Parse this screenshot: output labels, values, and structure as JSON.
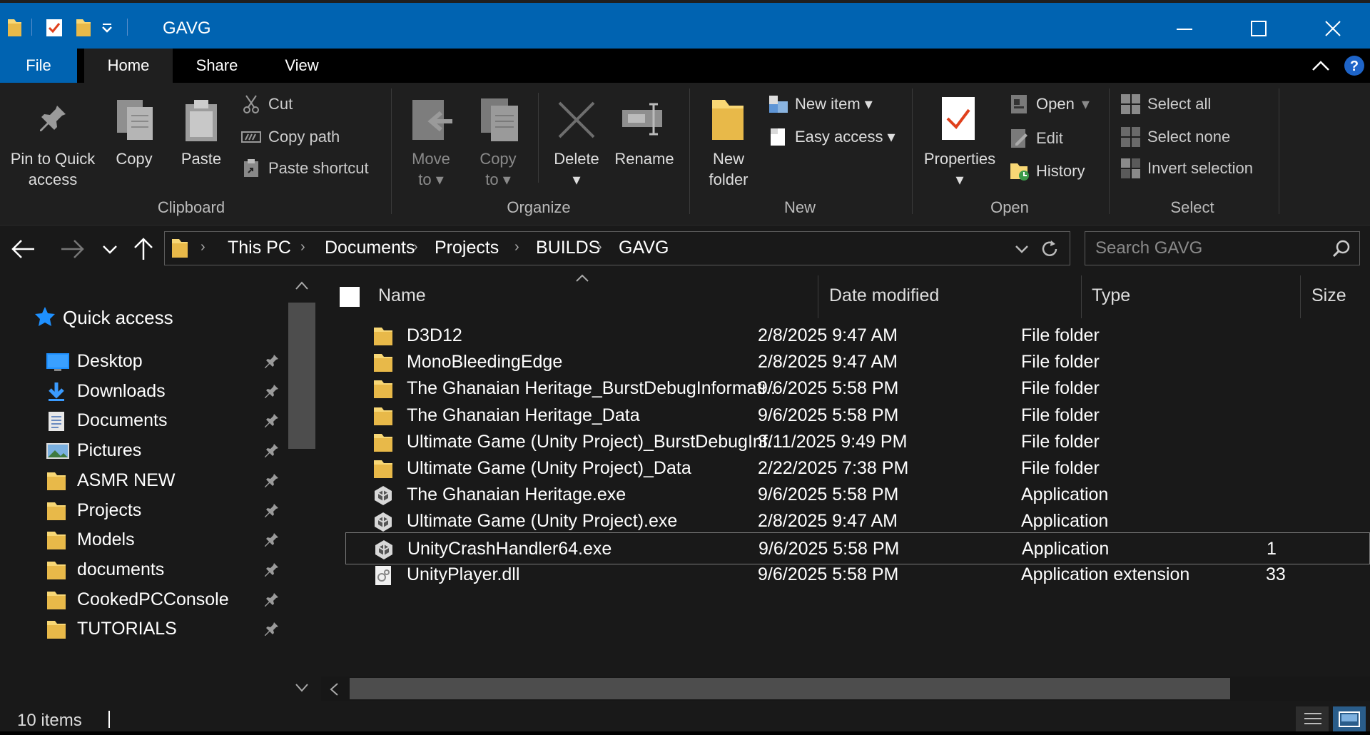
{
  "window": {
    "title": "GAVG",
    "minimize_glyph": "—",
    "maximize_glyph": "☐",
    "close_glyph": "✕"
  },
  "tabs": [
    {
      "label": "File",
      "active": false
    },
    {
      "label": "Home",
      "active": true
    },
    {
      "label": "Share",
      "active": false
    },
    {
      "label": "View",
      "active": false
    }
  ],
  "ribbon": {
    "clipboard": {
      "label": "Clipboard",
      "pin_line1": "Pin to Quick",
      "pin_line2": "access",
      "copy": "Copy",
      "paste": "Paste",
      "cut": "Cut",
      "copy_path": "Copy path",
      "paste_shortcut": "Paste shortcut"
    },
    "organize": {
      "label": "Organize",
      "move_line1": "Move",
      "move_line2": "to",
      "copy_line1": "Copy",
      "copy_line2": "to",
      "delete": "Delete",
      "rename": "Rename"
    },
    "new": {
      "label": "New",
      "new_folder_line1": "New",
      "new_folder_line2": "folder",
      "new_item": "New item",
      "easy_access": "Easy access"
    },
    "open": {
      "label": "Open",
      "properties": "Properties",
      "open": "Open",
      "edit": "Edit",
      "history": "History"
    },
    "select": {
      "label": "Select",
      "select_all": "Select all",
      "select_none": "Select none",
      "invert_selection": "Invert selection"
    }
  },
  "address": {
    "breadcrumbs": [
      "This PC",
      "Documents",
      "Projects",
      "BUILDS",
      "GAVG"
    ]
  },
  "search": {
    "placeholder": "Search GAVG"
  },
  "navigation": {
    "quick_access_label": "Quick access",
    "items": [
      {
        "label": "Desktop",
        "icon": "desktop-icon"
      },
      {
        "label": "Downloads",
        "icon": "downloads-icon"
      },
      {
        "label": "Documents",
        "icon": "documents-icon"
      },
      {
        "label": "Pictures",
        "icon": "pictures-icon"
      },
      {
        "label": "ASMR NEW",
        "icon": "folder-icon"
      },
      {
        "label": "Projects",
        "icon": "folder-icon"
      },
      {
        "label": "Models",
        "icon": "folder-icon"
      },
      {
        "label": "documents",
        "icon": "folder-icon"
      },
      {
        "label": "CookedPCConsole",
        "icon": "folder-icon"
      },
      {
        "label": "TUTORIALS",
        "icon": "folder-icon"
      }
    ]
  },
  "columns": {
    "name": "Name",
    "date": "Date modified",
    "type": "Type",
    "size": "Size"
  },
  "files": [
    {
      "name": "D3D12",
      "date": "2/8/2025 9:47 AM",
      "type": "File folder",
      "size": "",
      "icon": "folder-icon"
    },
    {
      "name": "MonoBleedingEdge",
      "date": "2/8/2025 9:47 AM",
      "type": "File folder",
      "size": "",
      "icon": "folder-icon"
    },
    {
      "name": "The Ghanaian Heritage_BurstDebugInformati...",
      "date": "9/6/2025 5:58 PM",
      "type": "File folder",
      "size": "",
      "icon": "folder-icon"
    },
    {
      "name": "The Ghanaian Heritage_Data",
      "date": "9/6/2025 5:58 PM",
      "type": "File folder",
      "size": "",
      "icon": "folder-icon"
    },
    {
      "name": "Ultimate Game (Unity Project)_BurstDebugInf...",
      "date": "3/11/2025 9:49 PM",
      "type": "File folder",
      "size": "",
      "icon": "folder-icon"
    },
    {
      "name": "Ultimate Game (Unity Project)_Data",
      "date": "2/22/2025 7:38 PM",
      "type": "File folder",
      "size": "",
      "icon": "folder-icon"
    },
    {
      "name": "The Ghanaian Heritage.exe",
      "date": "9/6/2025 5:58 PM",
      "type": "Application",
      "size": "",
      "icon": "unity-exe-icon"
    },
    {
      "name": "Ultimate Game (Unity Project).exe",
      "date": "2/8/2025 9:47 AM",
      "type": "Application",
      "size": "",
      "icon": "unity-exe-icon"
    },
    {
      "name": "UnityCrashHandler64.exe",
      "date": "9/6/2025 5:58 PM",
      "type": "Application",
      "size": "1",
      "icon": "unity-exe-icon",
      "selected": true
    },
    {
      "name": "UnityPlayer.dll",
      "date": "9/6/2025 5:58 PM",
      "type": "Application extension",
      "size": "33",
      "icon": "dll-icon"
    }
  ],
  "status": {
    "items_count": "10 items"
  },
  "colors": {
    "title_bar": "#0063b1",
    "ribbon_bg": "#1f1f1f",
    "content_bg": "#191919",
    "folder_yellow": "#f8d775",
    "accent_blue": "#1e90ff"
  }
}
